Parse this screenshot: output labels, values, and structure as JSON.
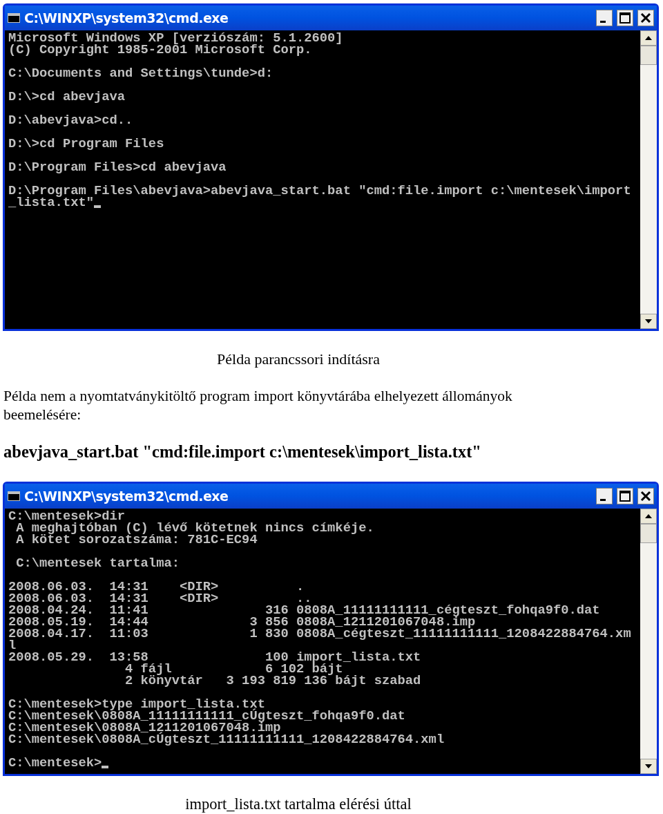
{
  "windows": [
    {
      "title": "C:\\WINXP\\system32\\cmd.exe",
      "cursor": true,
      "blocks": [
        {
          "lines": [
            "Microsoft Windows XP [verziószám: 5.1.2600]",
            "(C) Copyright 1985-2001 Microsoft Corp."
          ]
        },
        {
          "lines": [
            "C:\\Documents and Settings\\tunde>d:"
          ]
        },
        {
          "lines": [
            "D:\\>cd abevjava"
          ]
        },
        {
          "lines": [
            "D:\\abevjava>cd.."
          ]
        },
        {
          "lines": [
            "D:\\>cd Program Files"
          ]
        },
        {
          "lines": [
            "D:\\Program Files>cd abevjava"
          ]
        },
        {
          "lines": [
            "D:\\Program Files\\abevjava>abevjava_start.bat \"cmd:file.import c:\\mentesek\\import",
            "_lista.txt\""
          ]
        }
      ]
    },
    {
      "title": "C:\\WINXP\\system32\\cmd.exe",
      "cursor": true,
      "blocks": [
        {
          "lines": [
            "C:\\mentesek>dir",
            " A meghajtóban (C) lévő kötetnek nincs címkéje.",
            " A kötet sorozatszáma: 781C-EC94"
          ]
        },
        {
          "lines": [
            " C:\\mentesek tartalma:"
          ]
        },
        {
          "lines": [
            "2008.06.03.  14:31    <DIR>          .",
            "2008.06.03.  14:31    <DIR>          ..",
            "2008.04.24.  11:41               316 0808A_11111111111_cégteszt_fohqa9f0.dat",
            "2008.05.19.  14:44             3 856 0808A_1211201067048.imp",
            "2008.04.17.  11:03             1 830 0808A_cégteszt_11111111111_1208422884764.xm",
            "l",
            "2008.05.29.  13:58               100 import_lista.txt",
            "               4 fájl            6 102 bájt",
            "               2 könyvtár   3 193 819 136 bájt szabad"
          ]
        },
        {
          "lines": [
            "C:\\mentesek>type import_lista.txt",
            "C:\\mentesek\\0808A_11111111111_cÚgteszt_fohqa9f0.dat",
            "C:\\mentesek\\0808A_1211201067048.imp",
            "C:\\mentesek\\0808A_cÚgteszt_11111111111_1208422884764.xml"
          ]
        },
        {
          "lines": [
            "C:\\mentesek>"
          ]
        }
      ]
    }
  ],
  "caption_1": "Példa parancssori indításra",
  "paragraph": "Példa nem a nyomtatványkitöltő program import könyvtárába elhelyezett állományok beemelésére:",
  "command": "abevjava_start.bat \"cmd:file.import c:\\mentesek\\import_lista.txt\"",
  "caption_2": "import_lista.txt tartalma elérési úttal"
}
